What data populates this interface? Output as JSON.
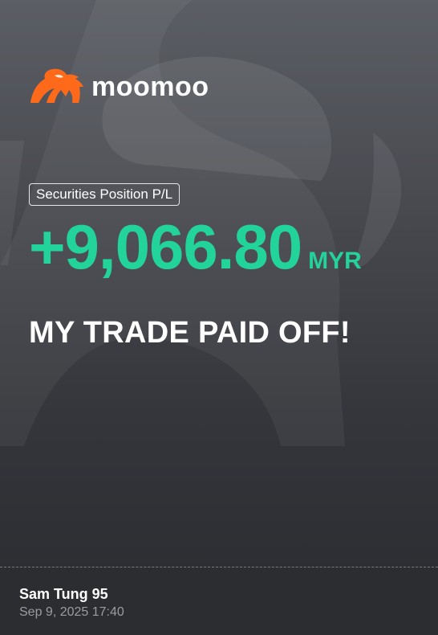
{
  "brand": {
    "name": "moomoo",
    "logo_icon": "bull-head-icon",
    "accent_color": "#ff6a1a"
  },
  "position": {
    "badge_label": "Securities Position P/L",
    "amount": "+9,066.80",
    "currency": "MYR",
    "profit_color": "#22d39a"
  },
  "headline": "MY TRADE PAID OFF!",
  "footer": {
    "user_name": "Sam Tung 95",
    "timestamp": "Sep 9, 2025 17:40"
  }
}
